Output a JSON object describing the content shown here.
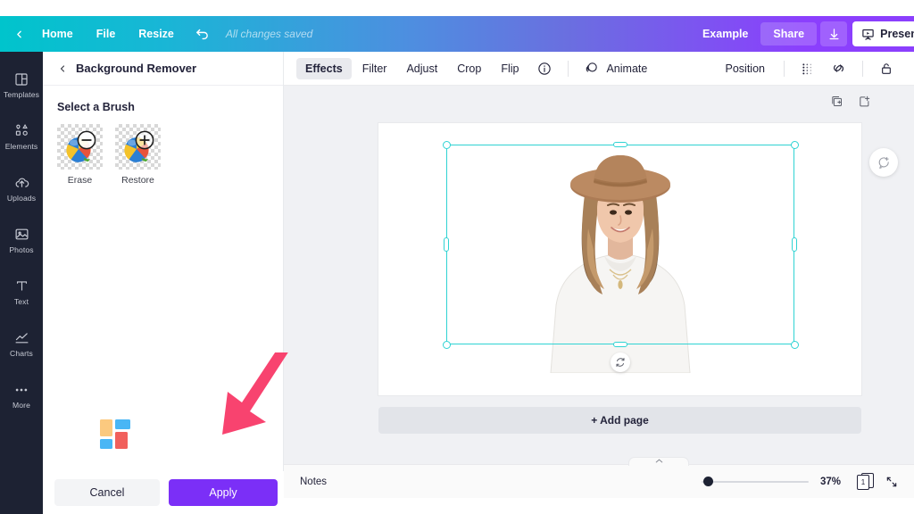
{
  "topbar": {
    "back_icon": "chevron-left-icon",
    "home_label": "Home",
    "file_label": "File",
    "resize_label": "Resize",
    "undo_icon": "undo-icon",
    "saved_status": "All changes saved",
    "account_label": "Example",
    "share_label": "Share",
    "download_icon": "download-icon",
    "present_label": "Present",
    "present_icon": "presentation-icon",
    "gradient_from": "#00c4cc",
    "gradient_to": "#8b3ffd"
  },
  "rail": {
    "items": [
      {
        "label": "Templates",
        "icon": "templates-icon"
      },
      {
        "label": "Elements",
        "icon": "elements-icon"
      },
      {
        "label": "Uploads",
        "icon": "uploads-icon"
      },
      {
        "label": "Photos",
        "icon": "photos-icon"
      },
      {
        "label": "Text",
        "icon": "text-icon"
      },
      {
        "label": "Charts",
        "icon": "charts-icon"
      },
      {
        "label": "More",
        "icon": "more-icon"
      }
    ],
    "background": "#1d2233"
  },
  "panel": {
    "back_icon": "chevron-left-icon",
    "title": "Background Remover",
    "section_title": "Select a Brush",
    "brushes": [
      {
        "label": "Erase",
        "icon": "minus-circle-icon"
      },
      {
        "label": "Restore",
        "icon": "plus-circle-icon"
      }
    ],
    "cancel_label": "Cancel",
    "apply_label": "Apply",
    "apply_color": "#7b2ff7",
    "logo_colors": [
      "#fbc97f",
      "#49b6f5",
      "#f1605c",
      "#49b6f5"
    ]
  },
  "objbar": {
    "tabs": [
      {
        "label": "Effects",
        "active": true
      },
      {
        "label": "Filter",
        "active": false
      },
      {
        "label": "Adjust",
        "active": false
      },
      {
        "label": "Crop",
        "active": false
      },
      {
        "label": "Flip",
        "active": false
      }
    ],
    "info_icon": "info-icon",
    "animate_label": "Animate",
    "animate_icon": "animate-icon",
    "position_label": "Position",
    "transparency_icon": "transparency-icon",
    "link_icon": "link-icon",
    "lock_icon": "lock-icon"
  },
  "stage": {
    "duplicate_page_icon": "duplicate-page-icon",
    "add_page_icon": "add-page-icon",
    "comment_icon": "add-comment-icon",
    "rotate_icon": "rotate-icon",
    "add_page_label": "+ Add page",
    "selection_color": "#2fd3d3",
    "photo_alt": "woman-with-hat-photo"
  },
  "bottombar": {
    "notes_label": "Notes",
    "collapse_icon": "chevron-up-icon",
    "zoom_percent": "37%",
    "page_number": "1",
    "expand_icon": "expand-icon"
  },
  "annotation": {
    "arrow_icon": "pink-arrow-icon",
    "arrow_color": "#f8436f"
  }
}
